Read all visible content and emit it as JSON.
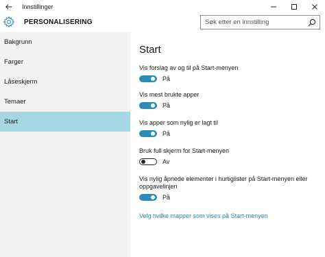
{
  "window": {
    "title": "Innstillinger",
    "back_icon": "arrow-left-icon",
    "controls": [
      "minimize-icon",
      "maximize-icon",
      "close-icon"
    ]
  },
  "header": {
    "title": "PERSONALISERING",
    "icon": "gear-icon",
    "search_placeholder": "Søk etter en innstilling"
  },
  "sidebar": {
    "items": [
      {
        "label": "Bakgrunn"
      },
      {
        "label": "Farger"
      },
      {
        "label": "Låseskjerm"
      },
      {
        "label": "Temaer"
      },
      {
        "label": "Start"
      }
    ],
    "selected": "Start"
  },
  "main": {
    "title": "Start",
    "settings": [
      {
        "label": "Vis forslag av og til på Start-menyen",
        "state": "På",
        "on": true
      },
      {
        "label": "Vis mest brukte apper",
        "state": "På",
        "on": true
      },
      {
        "label": "Vis apper som nylig er lagt til",
        "state": "På",
        "on": true
      },
      {
        "label": "Bruk full skjerm for Start-menyen",
        "state": "Av",
        "on": false
      },
      {
        "label": "Vis nylig åpnede elementer i hurtiglister på Start-menyen eller oppgavelinjen",
        "state": "På",
        "on": true
      }
    ],
    "link": "Velg hvilke mapper som vises på Start-menyen"
  },
  "colors": {
    "accent": "#2a8cb7",
    "sidebar_bg": "#f2f2f2",
    "selected_bg": "#a6d7e4",
    "link": "#2a86b3"
  }
}
